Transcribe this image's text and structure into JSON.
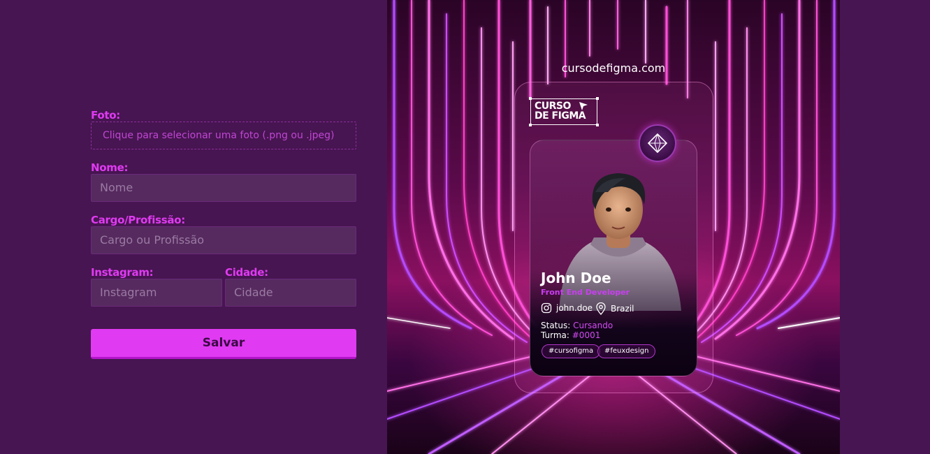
{
  "form": {
    "photo": {
      "label": "Foto:",
      "placeholder": "Clique para selecionar uma foto (.png ou .jpeg)"
    },
    "name": {
      "label": "Nome:",
      "placeholder": "Nome"
    },
    "role": {
      "label": "Cargo/Profissão:",
      "placeholder": "Cargo ou Profissão"
    },
    "instagram": {
      "label": "Instagram:",
      "placeholder": "Instagram"
    },
    "city": {
      "label": "Cidade:",
      "placeholder": "Cidade"
    },
    "save_label": "Salvar"
  },
  "preview": {
    "site_url": "cursodefigma.com",
    "logo": {
      "line1": "CURSO",
      "line2": "DE FIGMA"
    },
    "profile": {
      "name": "John Doe",
      "role": "Front End Developer",
      "instagram": "john.doe",
      "city": "Brazil",
      "status_label": "Status:",
      "status_value": "Cursando",
      "class_label": "Turma:",
      "class_value": "#0001",
      "tags": [
        "#cursofigma",
        "#feuxdesign"
      ]
    }
  },
  "colors": {
    "background": "#471551",
    "accent": "#e03af2",
    "input_bg": "#562a5f"
  },
  "icons": [
    "instagram-icon",
    "location-pin-icon",
    "diamond-badge-icon",
    "cursor-arrow-icon"
  ]
}
